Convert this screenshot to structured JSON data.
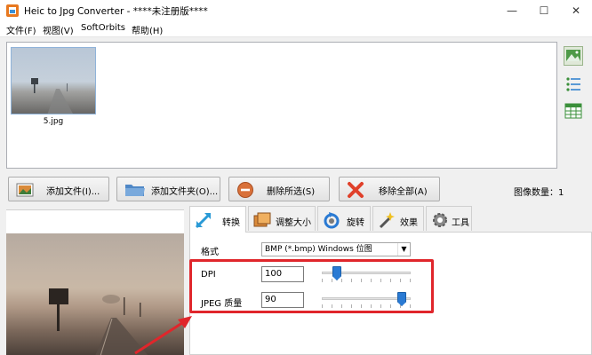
{
  "window": {
    "title": "Heic to Jpg Converter - ****未注册版****",
    "minimize": "—",
    "maximize": "☐",
    "close": "✕"
  },
  "menu": [
    "文件(F)",
    "视图(V)",
    "SoftOrbits",
    "帮助(H)"
  ],
  "thumbnails": [
    {
      "caption": "5.jpg"
    }
  ],
  "actions": {
    "add_file": "添加文件(I)...",
    "add_folder": "添加文件夹(O)...",
    "delete_selected": "删除所选(S)",
    "remove_all": "移除全部(A)"
  },
  "image_count": "图像数量：1",
  "tabs": [
    "转换",
    "调整大小",
    "旋转",
    "效果",
    "工具"
  ],
  "convert": {
    "format_label": "格式",
    "format_value": "BMP (*.bmp) Windows 位图",
    "dpi_label": "DPI",
    "dpi_value": "100",
    "dpi_level": 0.17,
    "quality_label": "JPEG 质量",
    "quality_value": "90",
    "quality_level": 0.9
  },
  "colors": {
    "accent": "#2a7ad3",
    "annotation": "#e0262b"
  }
}
